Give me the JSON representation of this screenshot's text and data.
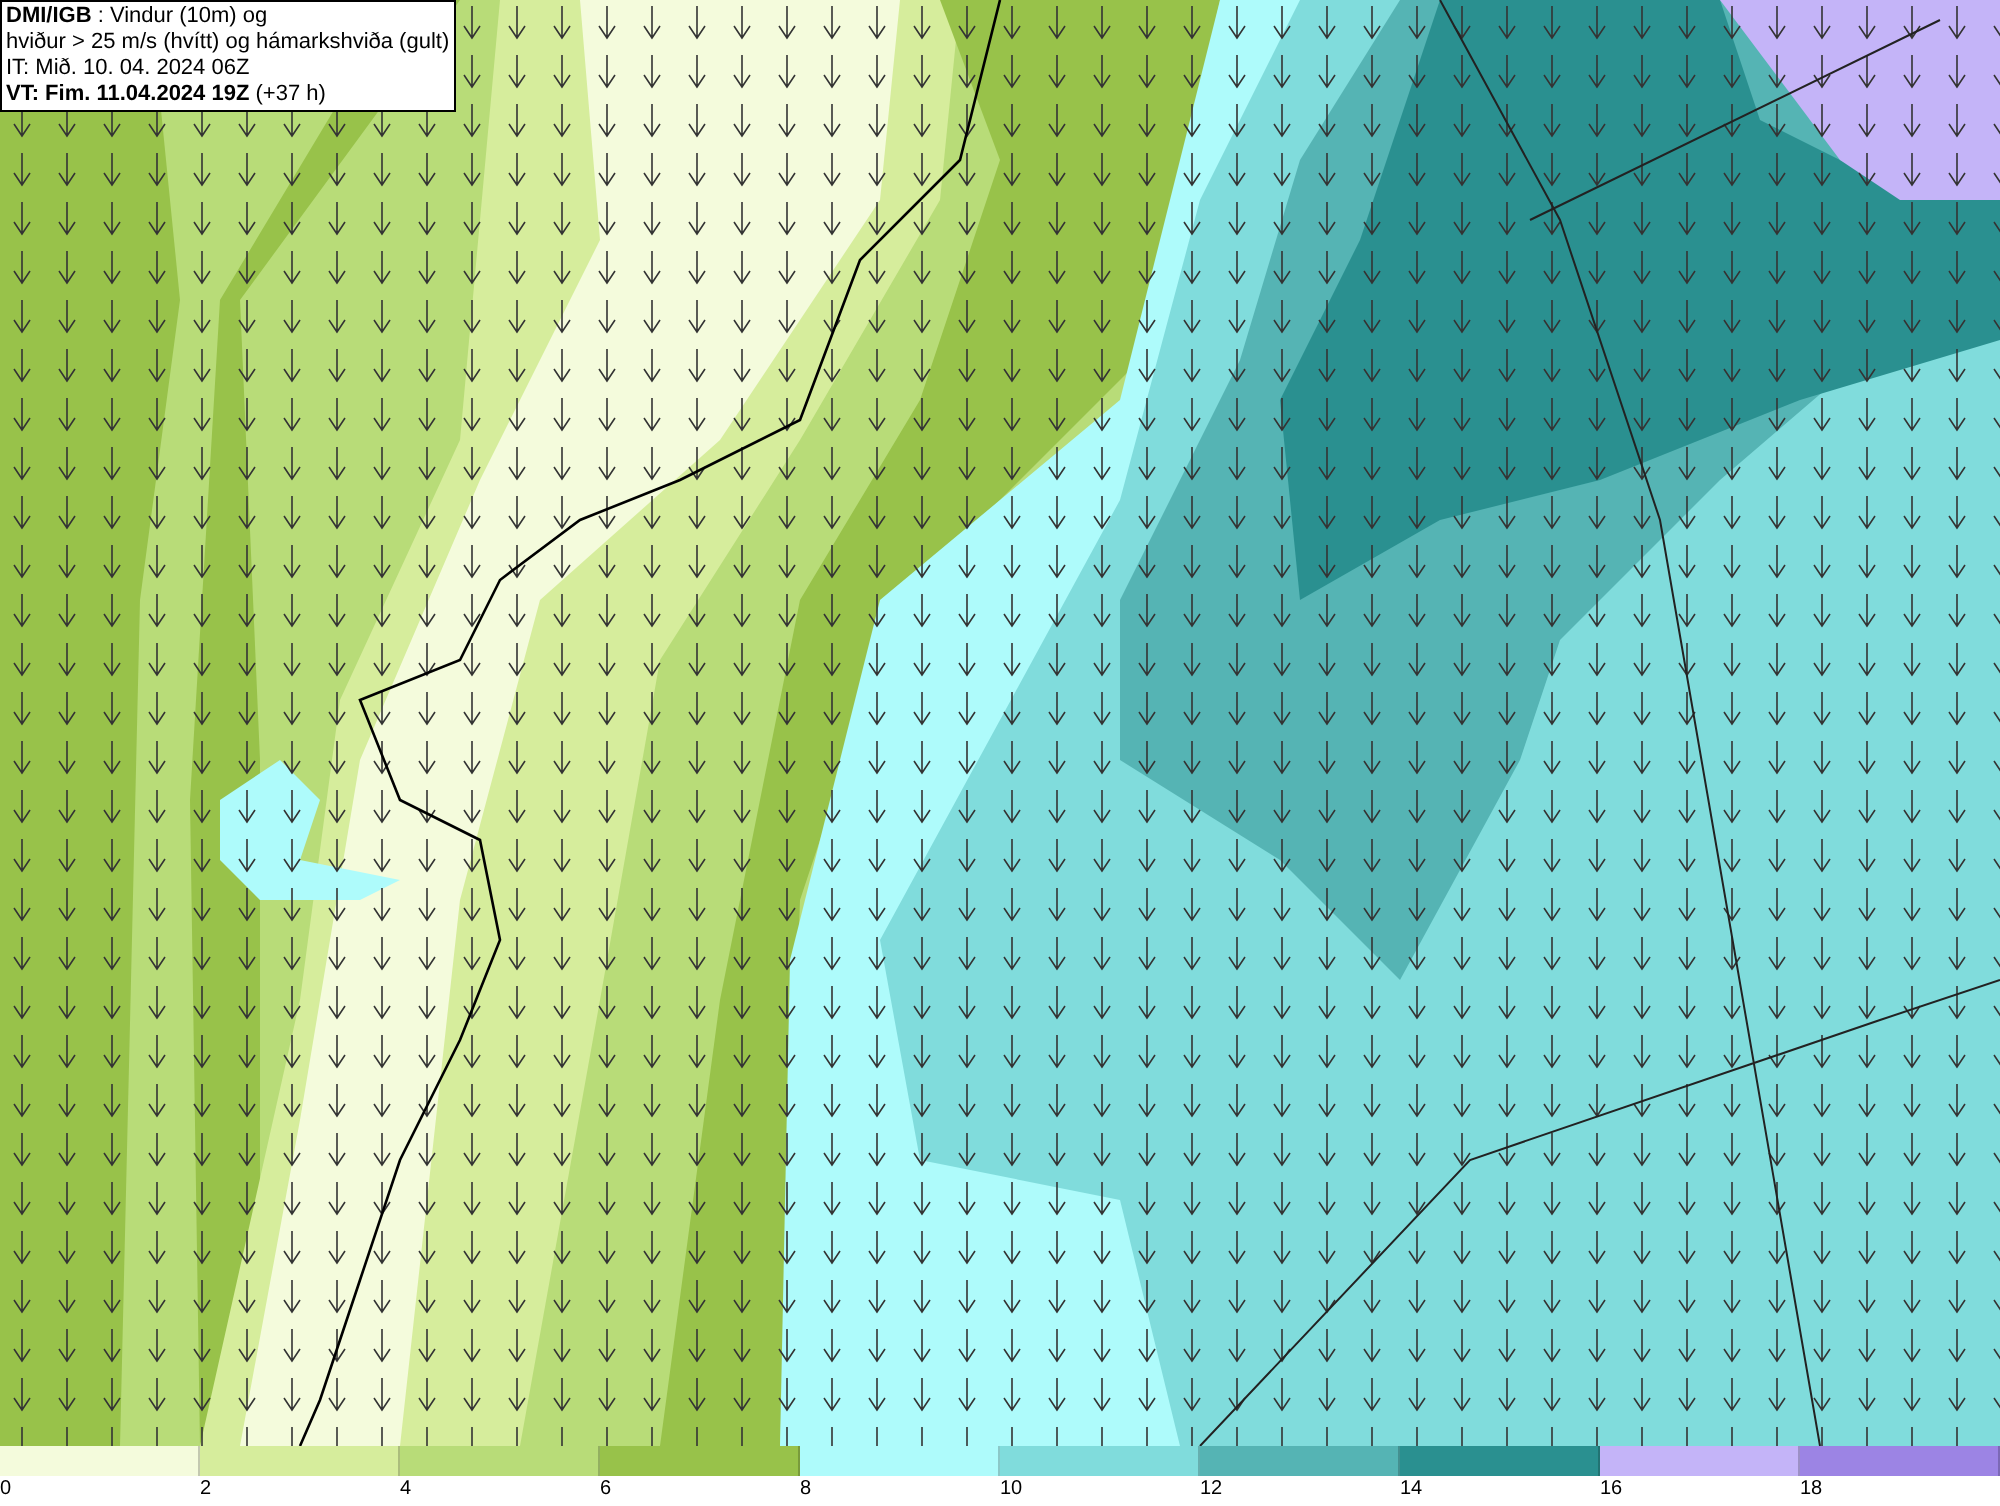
{
  "info_box": {
    "lines": [
      "**DMI/IGB** : Vindur (10m) og",
      "hviður > 25 m/s (hvítt) og hámarkshviða (gult)",
      "IT: Mið. 10. 04. 2024 06Z",
      "**VT: Fim. 11.04.2024 19Z** (+37 h)"
    ]
  },
  "legend": {
    "bins": [
      {
        "label": "0",
        "color": "#f4fbdc"
      },
      {
        "label": "2",
        "color": "#d6ed9c"
      },
      {
        "label": "4",
        "color": "#b8dc78"
      },
      {
        "label": "6",
        "color": "#98c24a"
      },
      {
        "label": "8",
        "color": "#aefbfb"
      },
      {
        "label": "10",
        "color": "#80dcdc"
      },
      {
        "label": "12",
        "color": "#55b4b4"
      },
      {
        "label": "14",
        "color": "#2a9090"
      },
      {
        "label": "16",
        "color": "#c4b4f8"
      },
      {
        "label": "18",
        "color": "#9c84e4"
      }
    ]
  }
}
